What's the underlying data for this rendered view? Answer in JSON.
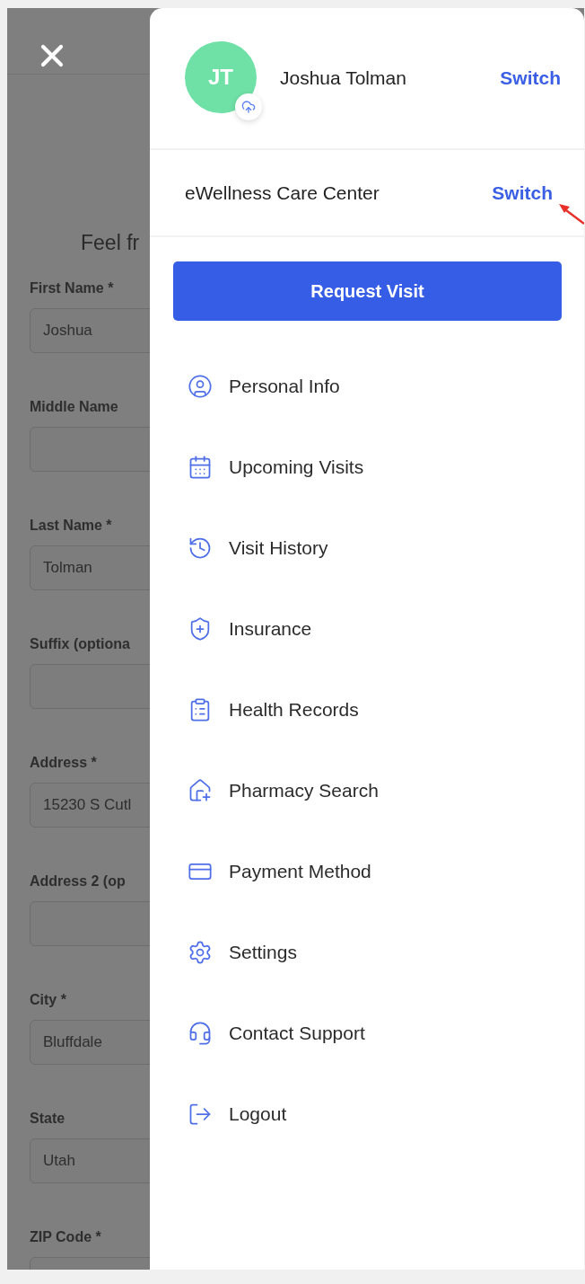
{
  "background_form": {
    "heading": "Feel fr",
    "fields": [
      {
        "label": "First Name *",
        "value": "Joshua"
      },
      {
        "label": "Middle Name"
      },
      {
        "label": "Last Name *",
        "value": "Tolman"
      },
      {
        "label": "Suffix (optiona"
      },
      {
        "label": "Address *",
        "value": "15230 S Cutl"
      },
      {
        "label": "Address 2 (op"
      },
      {
        "label": "City *",
        "value": "Bluffdale"
      },
      {
        "label": "State",
        "value": "Utah"
      },
      {
        "label": "ZIP Code *"
      }
    ]
  },
  "drawer": {
    "profile": {
      "initials": "JT",
      "name": "Joshua Tolman",
      "action": "Switch"
    },
    "organization": {
      "name": "eWellness Care Center",
      "action": "Switch"
    },
    "primary_button": "Request Visit",
    "menu": [
      {
        "label": "Personal Info"
      },
      {
        "label": "Upcoming Visits"
      },
      {
        "label": "Visit History"
      },
      {
        "label": "Insurance"
      },
      {
        "label": "Health Records"
      },
      {
        "label": "Pharmacy Search"
      },
      {
        "label": "Payment Method"
      },
      {
        "label": "Settings"
      },
      {
        "label": "Contact Support"
      },
      {
        "label": "Logout"
      }
    ]
  }
}
